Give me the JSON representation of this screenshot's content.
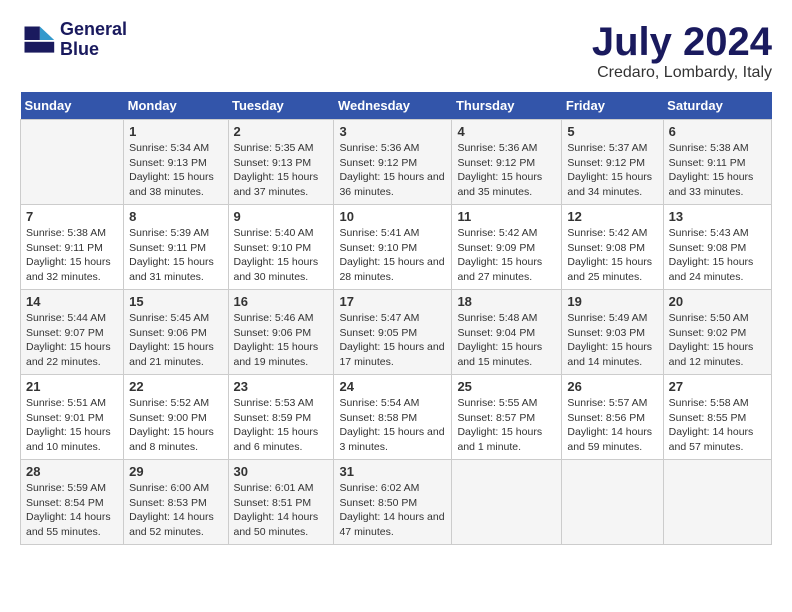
{
  "header": {
    "logo_line1": "General",
    "logo_line2": "Blue",
    "month": "July 2024",
    "location": "Credaro, Lombardy, Italy"
  },
  "days_of_week": [
    "Sunday",
    "Monday",
    "Tuesday",
    "Wednesday",
    "Thursday",
    "Friday",
    "Saturday"
  ],
  "weeks": [
    [
      {
        "day": "",
        "sunrise": "",
        "sunset": "",
        "daylight": ""
      },
      {
        "day": "1",
        "sunrise": "Sunrise: 5:34 AM",
        "sunset": "Sunset: 9:13 PM",
        "daylight": "Daylight: 15 hours and 38 minutes."
      },
      {
        "day": "2",
        "sunrise": "Sunrise: 5:35 AM",
        "sunset": "Sunset: 9:13 PM",
        "daylight": "Daylight: 15 hours and 37 minutes."
      },
      {
        "day": "3",
        "sunrise": "Sunrise: 5:36 AM",
        "sunset": "Sunset: 9:12 PM",
        "daylight": "Daylight: 15 hours and 36 minutes."
      },
      {
        "day": "4",
        "sunrise": "Sunrise: 5:36 AM",
        "sunset": "Sunset: 9:12 PM",
        "daylight": "Daylight: 15 hours and 35 minutes."
      },
      {
        "day": "5",
        "sunrise": "Sunrise: 5:37 AM",
        "sunset": "Sunset: 9:12 PM",
        "daylight": "Daylight: 15 hours and 34 minutes."
      },
      {
        "day": "6",
        "sunrise": "Sunrise: 5:38 AM",
        "sunset": "Sunset: 9:11 PM",
        "daylight": "Daylight: 15 hours and 33 minutes."
      }
    ],
    [
      {
        "day": "7",
        "sunrise": "Sunrise: 5:38 AM",
        "sunset": "Sunset: 9:11 PM",
        "daylight": "Daylight: 15 hours and 32 minutes."
      },
      {
        "day": "8",
        "sunrise": "Sunrise: 5:39 AM",
        "sunset": "Sunset: 9:11 PM",
        "daylight": "Daylight: 15 hours and 31 minutes."
      },
      {
        "day": "9",
        "sunrise": "Sunrise: 5:40 AM",
        "sunset": "Sunset: 9:10 PM",
        "daylight": "Daylight: 15 hours and 30 minutes."
      },
      {
        "day": "10",
        "sunrise": "Sunrise: 5:41 AM",
        "sunset": "Sunset: 9:10 PM",
        "daylight": "Daylight: 15 hours and 28 minutes."
      },
      {
        "day": "11",
        "sunrise": "Sunrise: 5:42 AM",
        "sunset": "Sunset: 9:09 PM",
        "daylight": "Daylight: 15 hours and 27 minutes."
      },
      {
        "day": "12",
        "sunrise": "Sunrise: 5:42 AM",
        "sunset": "Sunset: 9:08 PM",
        "daylight": "Daylight: 15 hours and 25 minutes."
      },
      {
        "day": "13",
        "sunrise": "Sunrise: 5:43 AM",
        "sunset": "Sunset: 9:08 PM",
        "daylight": "Daylight: 15 hours and 24 minutes."
      }
    ],
    [
      {
        "day": "14",
        "sunrise": "Sunrise: 5:44 AM",
        "sunset": "Sunset: 9:07 PM",
        "daylight": "Daylight: 15 hours and 22 minutes."
      },
      {
        "day": "15",
        "sunrise": "Sunrise: 5:45 AM",
        "sunset": "Sunset: 9:06 PM",
        "daylight": "Daylight: 15 hours and 21 minutes."
      },
      {
        "day": "16",
        "sunrise": "Sunrise: 5:46 AM",
        "sunset": "Sunset: 9:06 PM",
        "daylight": "Daylight: 15 hours and 19 minutes."
      },
      {
        "day": "17",
        "sunrise": "Sunrise: 5:47 AM",
        "sunset": "Sunset: 9:05 PM",
        "daylight": "Daylight: 15 hours and 17 minutes."
      },
      {
        "day": "18",
        "sunrise": "Sunrise: 5:48 AM",
        "sunset": "Sunset: 9:04 PM",
        "daylight": "Daylight: 15 hours and 15 minutes."
      },
      {
        "day": "19",
        "sunrise": "Sunrise: 5:49 AM",
        "sunset": "Sunset: 9:03 PM",
        "daylight": "Daylight: 15 hours and 14 minutes."
      },
      {
        "day": "20",
        "sunrise": "Sunrise: 5:50 AM",
        "sunset": "Sunset: 9:02 PM",
        "daylight": "Daylight: 15 hours and 12 minutes."
      }
    ],
    [
      {
        "day": "21",
        "sunrise": "Sunrise: 5:51 AM",
        "sunset": "Sunset: 9:01 PM",
        "daylight": "Daylight: 15 hours and 10 minutes."
      },
      {
        "day": "22",
        "sunrise": "Sunrise: 5:52 AM",
        "sunset": "Sunset: 9:00 PM",
        "daylight": "Daylight: 15 hours and 8 minutes."
      },
      {
        "day": "23",
        "sunrise": "Sunrise: 5:53 AM",
        "sunset": "Sunset: 8:59 PM",
        "daylight": "Daylight: 15 hours and 6 minutes."
      },
      {
        "day": "24",
        "sunrise": "Sunrise: 5:54 AM",
        "sunset": "Sunset: 8:58 PM",
        "daylight": "Daylight: 15 hours and 3 minutes."
      },
      {
        "day": "25",
        "sunrise": "Sunrise: 5:55 AM",
        "sunset": "Sunset: 8:57 PM",
        "daylight": "Daylight: 15 hours and 1 minute."
      },
      {
        "day": "26",
        "sunrise": "Sunrise: 5:57 AM",
        "sunset": "Sunset: 8:56 PM",
        "daylight": "Daylight: 14 hours and 59 minutes."
      },
      {
        "day": "27",
        "sunrise": "Sunrise: 5:58 AM",
        "sunset": "Sunset: 8:55 PM",
        "daylight": "Daylight: 14 hours and 57 minutes."
      }
    ],
    [
      {
        "day": "28",
        "sunrise": "Sunrise: 5:59 AM",
        "sunset": "Sunset: 8:54 PM",
        "daylight": "Daylight: 14 hours and 55 minutes."
      },
      {
        "day": "29",
        "sunrise": "Sunrise: 6:00 AM",
        "sunset": "Sunset: 8:53 PM",
        "daylight": "Daylight: 14 hours and 52 minutes."
      },
      {
        "day": "30",
        "sunrise": "Sunrise: 6:01 AM",
        "sunset": "Sunset: 8:51 PM",
        "daylight": "Daylight: 14 hours and 50 minutes."
      },
      {
        "day": "31",
        "sunrise": "Sunrise: 6:02 AM",
        "sunset": "Sunset: 8:50 PM",
        "daylight": "Daylight: 14 hours and 47 minutes."
      },
      {
        "day": "",
        "sunrise": "",
        "sunset": "",
        "daylight": ""
      },
      {
        "day": "",
        "sunrise": "",
        "sunset": "",
        "daylight": ""
      },
      {
        "day": "",
        "sunrise": "",
        "sunset": "",
        "daylight": ""
      }
    ]
  ]
}
